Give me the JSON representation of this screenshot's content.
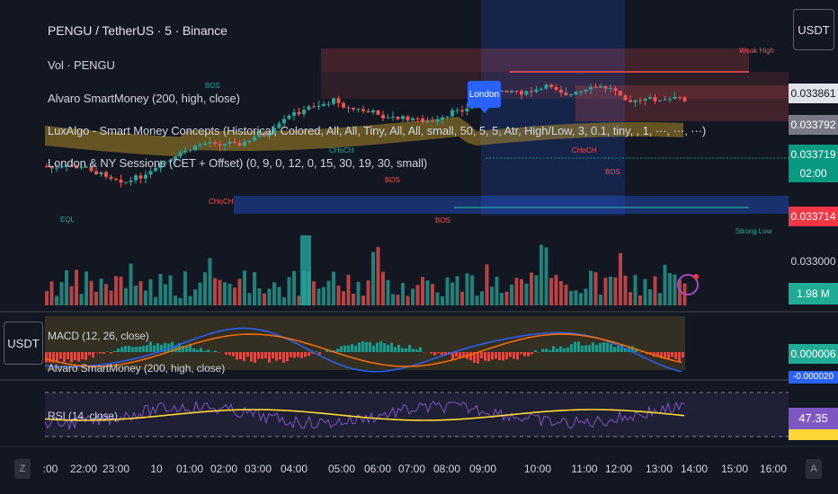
{
  "header": {
    "symbol_title": "PENGU / TetherUS · 5 · Binance",
    "indicators": [
      "Vol · PENGU",
      "Alvaro SmartMoney (200, high, close)",
      "LuxAlgo - Smart Money Concepts (Historical, Colored, All, All, Tiny, All, All, small, 50, 5, 5, Atr, High/Low, 3, 0.1, tiny, , 1, ···, ···, ···)",
      "London & NY Sessions (CET + Offset) (0, 9, 0, 12, 0, 15, 30, 19, 30, small)"
    ]
  },
  "price_axis": {
    "currency_button": "USDT",
    "levels": {
      "p1": "0.033861",
      "p2": "0.033792",
      "p3": "0.033719",
      "countdown": "02:00",
      "p4": "0.033714",
      "p5": "0.033000",
      "volume": "1.98 M"
    }
  },
  "macd_pane": {
    "currency_button": "USDT",
    "legend": "MACD (12, 26, close)",
    "legend2": "Alvaro SmartMoney (200, high, close)",
    "value1": "0.000006",
    "value2": "-0.000020"
  },
  "rsi_pane": {
    "legend": "RSI (14, close)",
    "value": "47.35"
  },
  "annotations": {
    "london_flag": "London",
    "weak_high": "Weak High",
    "strong_low": "Strong Low",
    "eql": "EQL",
    "bos1": "BOS",
    "bos2": "BOS",
    "bos3": "BOS",
    "bos4": "BOS",
    "choch1": "CHoCH",
    "choch2": "CHoCH",
    "choch3": "CHoCH"
  },
  "time_axis": {
    "labels": [
      ":00",
      "22:00",
      "23:00",
      "10",
      "01:00",
      "02:00",
      "03:00",
      "04:00",
      "05:00",
      "06:00",
      "07:00",
      "08:00",
      "09:00",
      "10:00",
      "11:00",
      "12:00",
      "13:00",
      "14:00",
      "15:00",
      "16:00"
    ],
    "left_corner": "Z",
    "right_corner": "A"
  },
  "colors": {
    "background": "#131722",
    "bull": "#26a69a",
    "bear": "#ef5350",
    "session": "#2962ff",
    "ema_band": "#c9a227",
    "rsi_line": "#7e57c2",
    "rsi_ma": "#fdd835",
    "macd_line": "#2962ff",
    "signal_line": "#ff6d00"
  }
}
